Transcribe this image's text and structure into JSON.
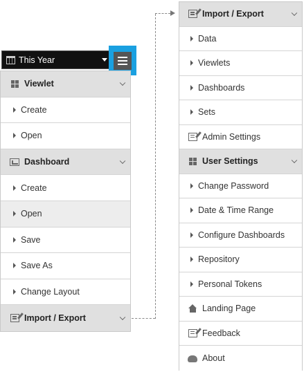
{
  "time_filter": {
    "label": "This Year",
    "icon": "calendar-icon"
  },
  "menu_button": {
    "icon": "hamburger-icon",
    "accent": "#1aa0e0"
  },
  "left_menu": {
    "viewlet_header": "Viewlet",
    "viewlet_items": [
      "Create",
      "Open"
    ],
    "dashboard_header": "Dashboard",
    "dashboard_items": [
      "Create",
      "Open",
      "Save",
      "Save As",
      "Change Layout"
    ],
    "selected_item": "Open",
    "import_export_header": "Import / Export"
  },
  "right_menu": {
    "import_export_header": "Import / Export",
    "import_export_items": [
      "Data",
      "Viewlets",
      "Dashboards",
      "Sets"
    ],
    "admin_settings": "Admin Settings",
    "user_settings_header": "User Settings",
    "user_settings_items": [
      "Change Password",
      "Date & Time Range",
      "Configure Dashboards",
      "Repository",
      "Personal Tokens"
    ],
    "landing_page": "Landing Page",
    "feedback": "Feedback",
    "about": "About"
  }
}
